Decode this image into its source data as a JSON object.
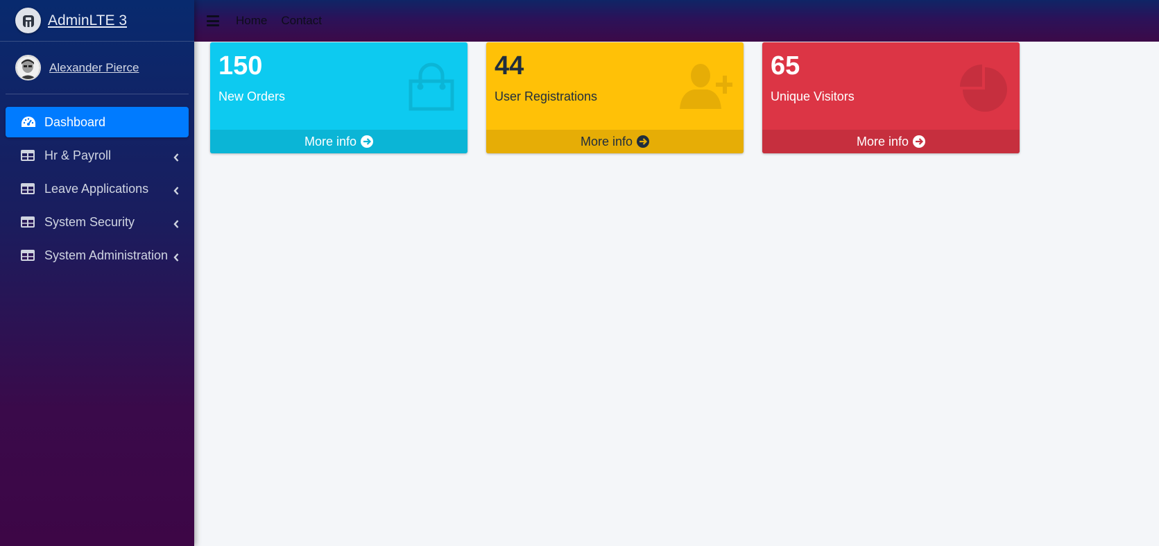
{
  "brand": {
    "title": "AdminLTE 3",
    "logo_icon": "adminlte-logo-icon"
  },
  "user": {
    "name": "Alexander Pierce"
  },
  "sidebar": {
    "items": [
      {
        "label": "Dashboard",
        "icon": "tachometer-icon",
        "active": true
      },
      {
        "label": "Hr & Payroll",
        "icon": "table-icon"
      },
      {
        "label": "Leave Applications",
        "icon": "table-icon"
      },
      {
        "label": "System Security",
        "icon": "table-icon"
      },
      {
        "label": "System Administration",
        "icon": "table-icon"
      }
    ]
  },
  "topbar": {
    "links": [
      "Home",
      "Contact"
    ]
  },
  "boxes": [
    {
      "number": "150",
      "label": "New Orders",
      "footer": "More info",
      "icon": "shopping-bag-icon",
      "color": "#0dcaf0"
    },
    {
      "number": "44",
      "label": "User Registrations",
      "footer": "More info",
      "icon": "user-plus-icon",
      "color": "#ffc107"
    },
    {
      "number": "65",
      "label": "Unique Visitors",
      "footer": "More info",
      "icon": "pie-chart-icon",
      "color": "#dc3545"
    }
  ],
  "colors": {
    "active_nav": "#007bff",
    "content_bg": "#f4f6f9"
  }
}
